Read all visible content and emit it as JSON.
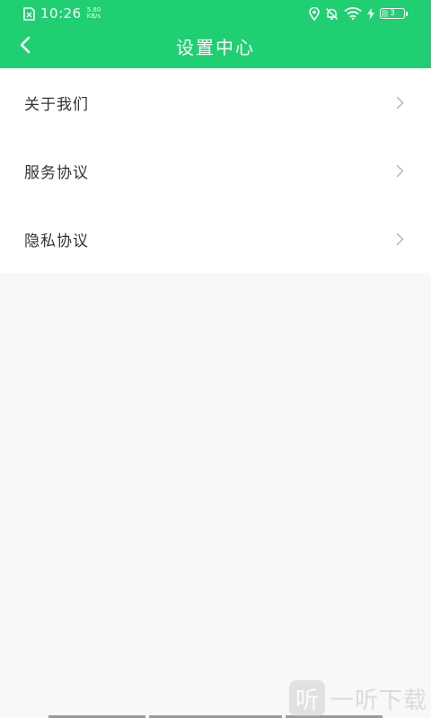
{
  "status_bar": {
    "time": "10:26",
    "speed_value": "5.80",
    "speed_unit": "KB/s",
    "battery_level": 0.3,
    "battery_label": "3"
  },
  "header": {
    "title": "设置中心",
    "back_icon": "chevron-left-icon"
  },
  "menu": {
    "items": [
      {
        "label": "关于我们"
      },
      {
        "label": "服务协议"
      },
      {
        "label": "隐私协议"
      }
    ]
  },
  "watermark": {
    "logo_char": "听",
    "text": "一听下载"
  },
  "colors": {
    "header_bg": "#1fcf72",
    "page_bg": "#f8f8f8",
    "item_text": "#333333",
    "chevron": "#b5b5b5"
  }
}
